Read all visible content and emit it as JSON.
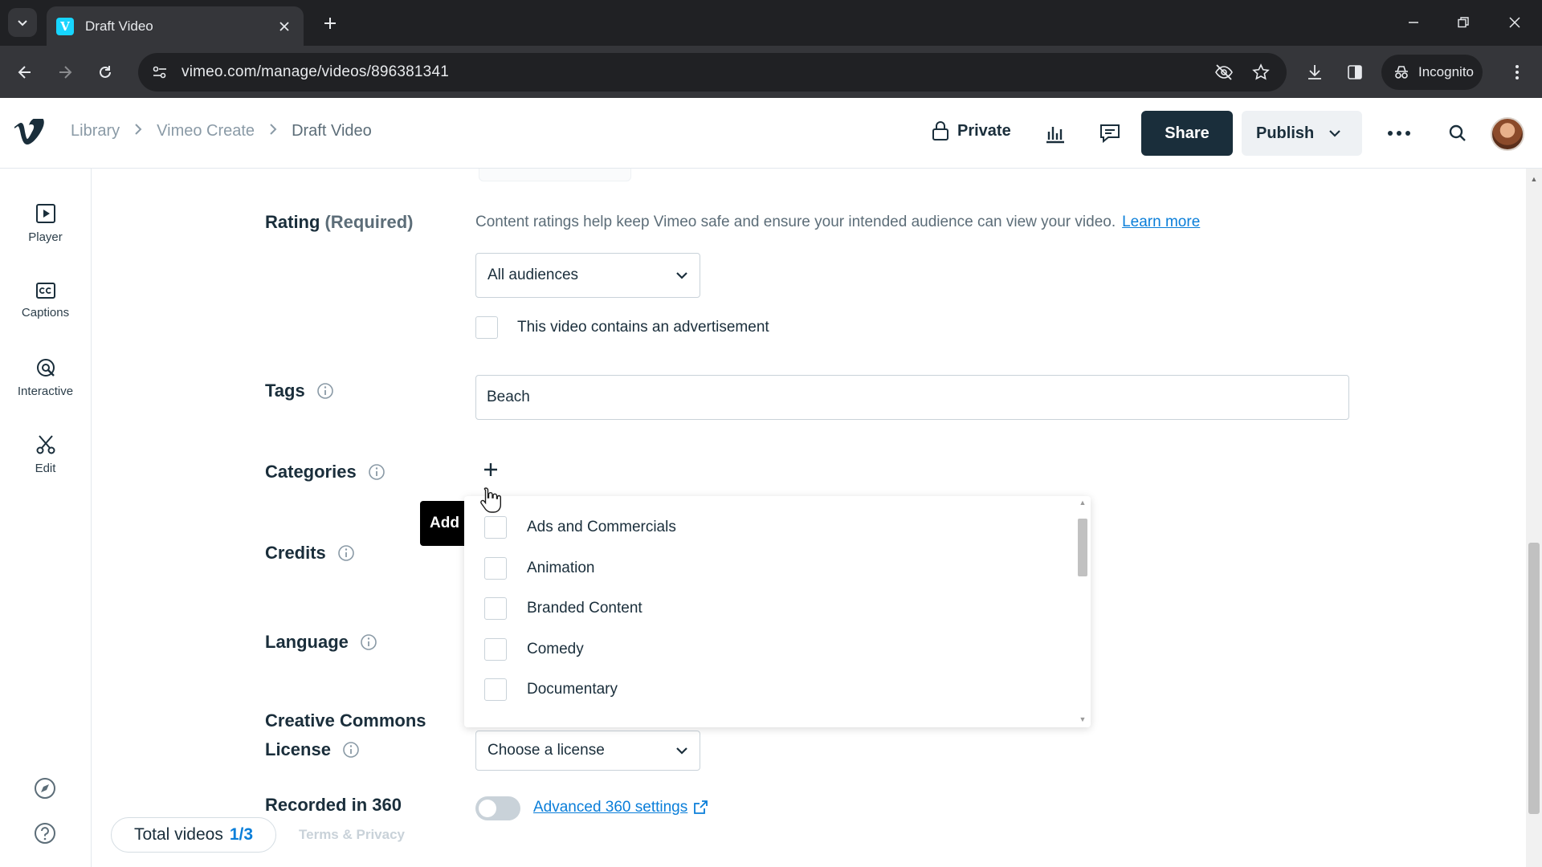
{
  "browser": {
    "tab_title": "Draft Video",
    "url": "vimeo.com/manage/videos/896381341",
    "incognito_label": "Incognito"
  },
  "header": {
    "breadcrumbs": [
      "Library",
      "Vimeo Create",
      "Draft Video"
    ],
    "privacy_label": "Private",
    "share_label": "Share",
    "publish_label": "Publish"
  },
  "sidebar": {
    "items": [
      {
        "label": "Player",
        "icon": "play-square-icon"
      },
      {
        "label": "Captions",
        "icon": "cc-icon"
      },
      {
        "label": "Interactive",
        "icon": "interactive-icon"
      },
      {
        "label": "Edit",
        "icon": "scissors-icon"
      }
    ]
  },
  "form": {
    "rating": {
      "label": "Rating",
      "required_note": "(Required)",
      "help": "Content ratings help keep Vimeo safe and ensure your intended audience can view your video.",
      "learn_more": "Learn more",
      "selected": "All audiences",
      "ad_checkbox_label": "This video contains an advertisement"
    },
    "tags": {
      "label": "Tags",
      "value": "Beach"
    },
    "categories": {
      "label": "Categories",
      "tooltip": "Add c"
    },
    "credits": {
      "label": "Credits"
    },
    "language": {
      "label": "Language"
    },
    "license": {
      "label_line1": "Creative Commons",
      "label_line2": "License",
      "selected": "Choose a license"
    },
    "recorded_360": {
      "label": "Recorded in 360",
      "link": "Advanced 360 settings",
      "enabled": false
    }
  },
  "categories_dropdown": {
    "options": [
      "Ads and Commercials",
      "Animation",
      "Branded Content",
      "Comedy",
      "Documentary"
    ]
  },
  "footer": {
    "total_label": "Total videos",
    "total_value": "1/3",
    "terms": "Terms & Privacy"
  },
  "colors": {
    "accent": "#0a7ed9",
    "primary_dark": "#1a2e3b",
    "chrome_dark": "#202124"
  }
}
